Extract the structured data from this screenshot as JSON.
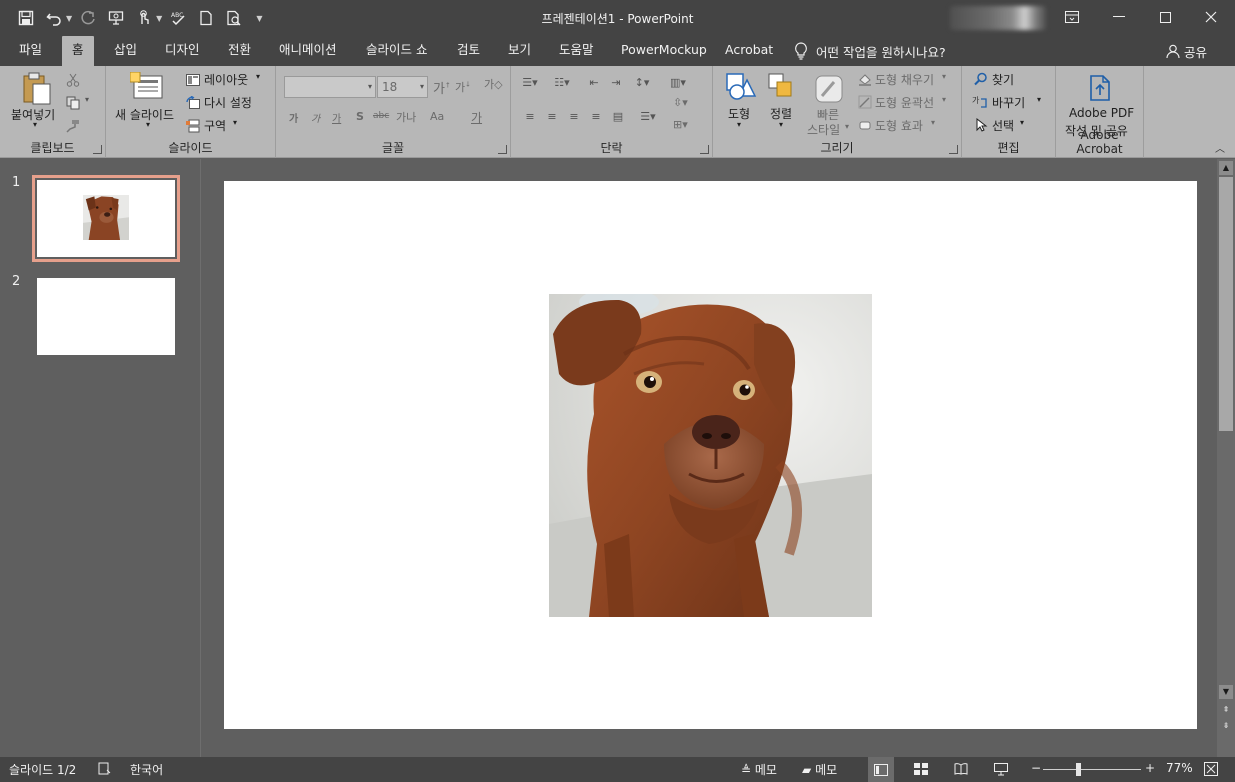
{
  "window": {
    "title": "프레젠테이션1  -  PowerPoint"
  },
  "qat": {
    "icons": [
      "save-icon",
      "undo-icon",
      "redo-icon",
      "present-from-start-icon",
      "touch-mode-icon",
      "spell-check-icon",
      "new-icon",
      "print-preview-icon",
      "customize-qat-icon"
    ]
  },
  "tabs": [
    {
      "label": "파일"
    },
    {
      "label": "홈"
    },
    {
      "label": "삽입"
    },
    {
      "label": "디자인"
    },
    {
      "label": "전환"
    },
    {
      "label": "애니메이션"
    },
    {
      "label": "슬라이드 쇼"
    },
    {
      "label": "검토"
    },
    {
      "label": "보기"
    },
    {
      "label": "도움말"
    },
    {
      "label": "PowerMockup"
    },
    {
      "label": "Acrobat"
    }
  ],
  "tell_me": "어떤 작업을 원하시나요?",
  "share": "공유",
  "ribbon": {
    "clipboard": {
      "paste": "붙여넣기",
      "label": "클립보드"
    },
    "slides": {
      "new_slide": "새 슬라이드",
      "layout": "레이아웃",
      "reset": "다시 설정",
      "section": "구역",
      "label": "슬라이드"
    },
    "font": {
      "font_name": "",
      "font_size": "18",
      "label": "글꼴",
      "buttons": [
        "가",
        "가",
        "가",
        "S",
        "abc",
        "가나",
        "Aa",
        "가"
      ]
    },
    "paragraph": {
      "label": "단락"
    },
    "drawing": {
      "shapes": "도형",
      "arrange": "정렬",
      "quick_styles_1": "빠른",
      "quick_styles_2": "스타일",
      "shape_fill": "도형 채우기",
      "shape_outline": "도형 윤곽선",
      "shape_effects": "도형 효과",
      "label": "그리기"
    },
    "editing": {
      "find": "찾기",
      "replace": "바꾸기",
      "select": "선택",
      "label": "편집"
    },
    "acrobat": {
      "create_1": "Adobe PDF",
      "create_2": "작성 및 공유",
      "label": "Adobe Acrobat"
    }
  },
  "slides": [
    {
      "number": "1",
      "has_image": true
    },
    {
      "number": "2",
      "has_image": false
    }
  ],
  "status": {
    "slide_pos": "슬라이드 1/2",
    "language": "한국어",
    "notes": "메모",
    "comments": "메모",
    "zoom": "77%",
    "zoom_minus": "−",
    "zoom_plus": "+"
  }
}
